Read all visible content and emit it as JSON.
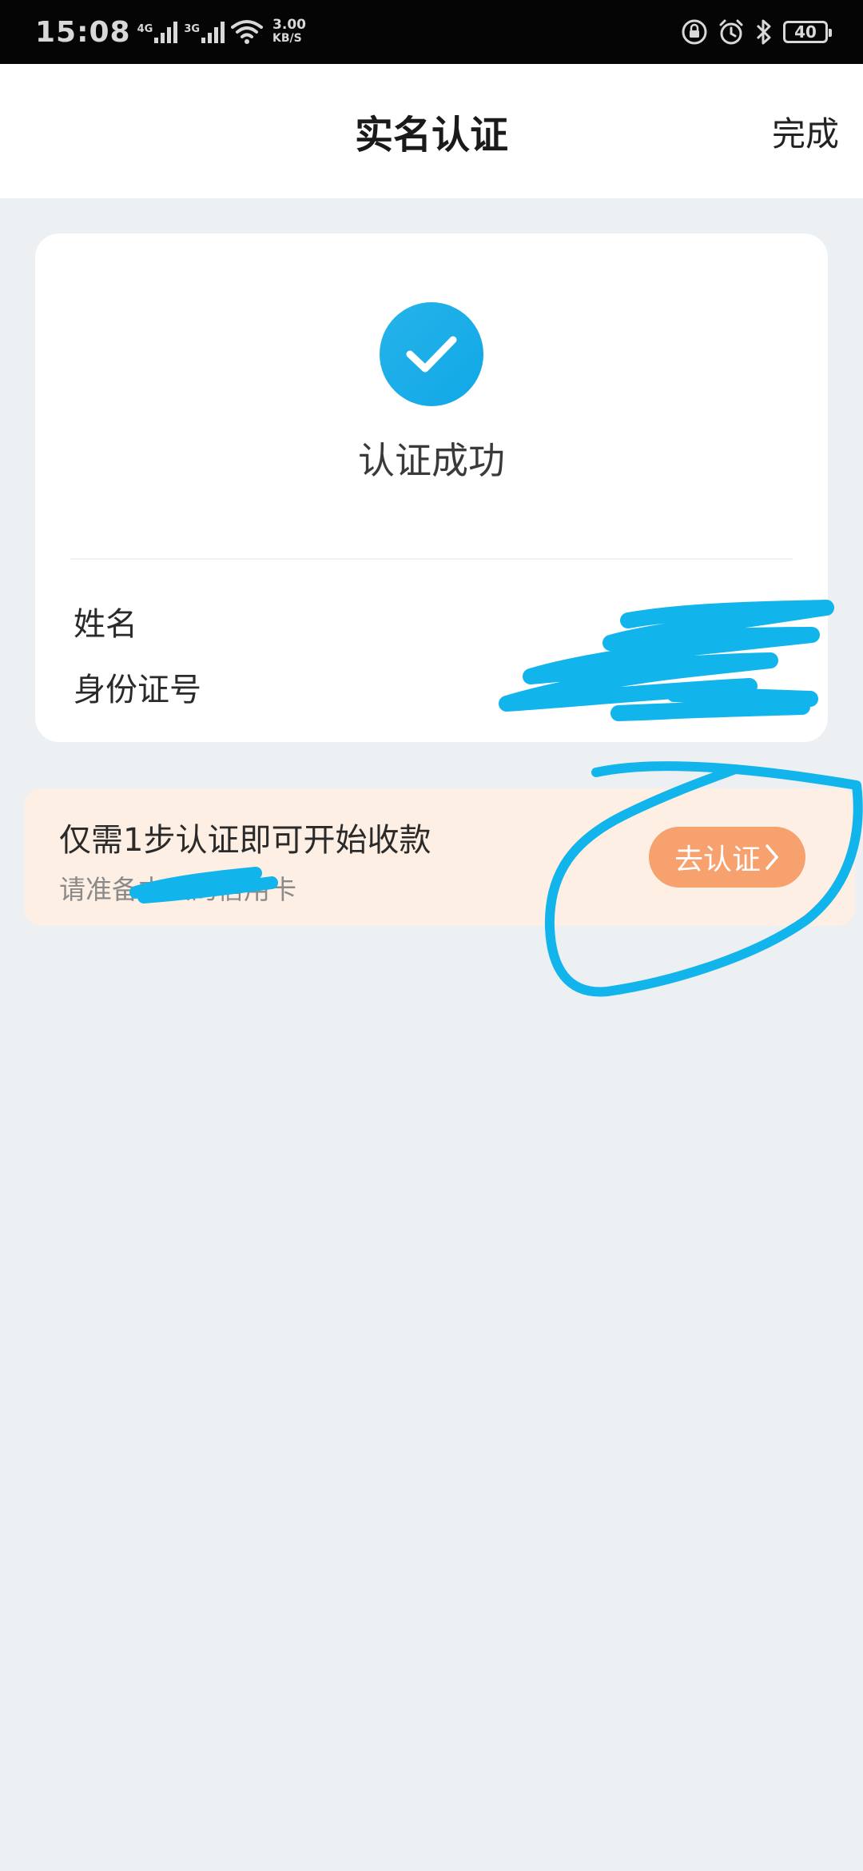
{
  "status_bar": {
    "time": "15:08",
    "network_1": "4G",
    "network_2": "3G",
    "speed_value": "3.00",
    "speed_unit": "KB/S",
    "battery": "40"
  },
  "nav": {
    "title": "实名认证",
    "done_label": "完成"
  },
  "result": {
    "status_text": "认证成功",
    "status_icon": "check-circle-icon",
    "name_label": "姓名",
    "id_label": "身份证号"
  },
  "banner": {
    "title": "仅需1步认证即可开始收款",
    "subtitle": "请准备本人的信用卡",
    "button_label": "去认证"
  },
  "colors": {
    "accent_blue": "#1aaee8",
    "button_orange": "#f7a16f",
    "banner_bg": "#fdefe4",
    "page_bg": "#edf0f3",
    "scribble": "#12b4ec"
  }
}
